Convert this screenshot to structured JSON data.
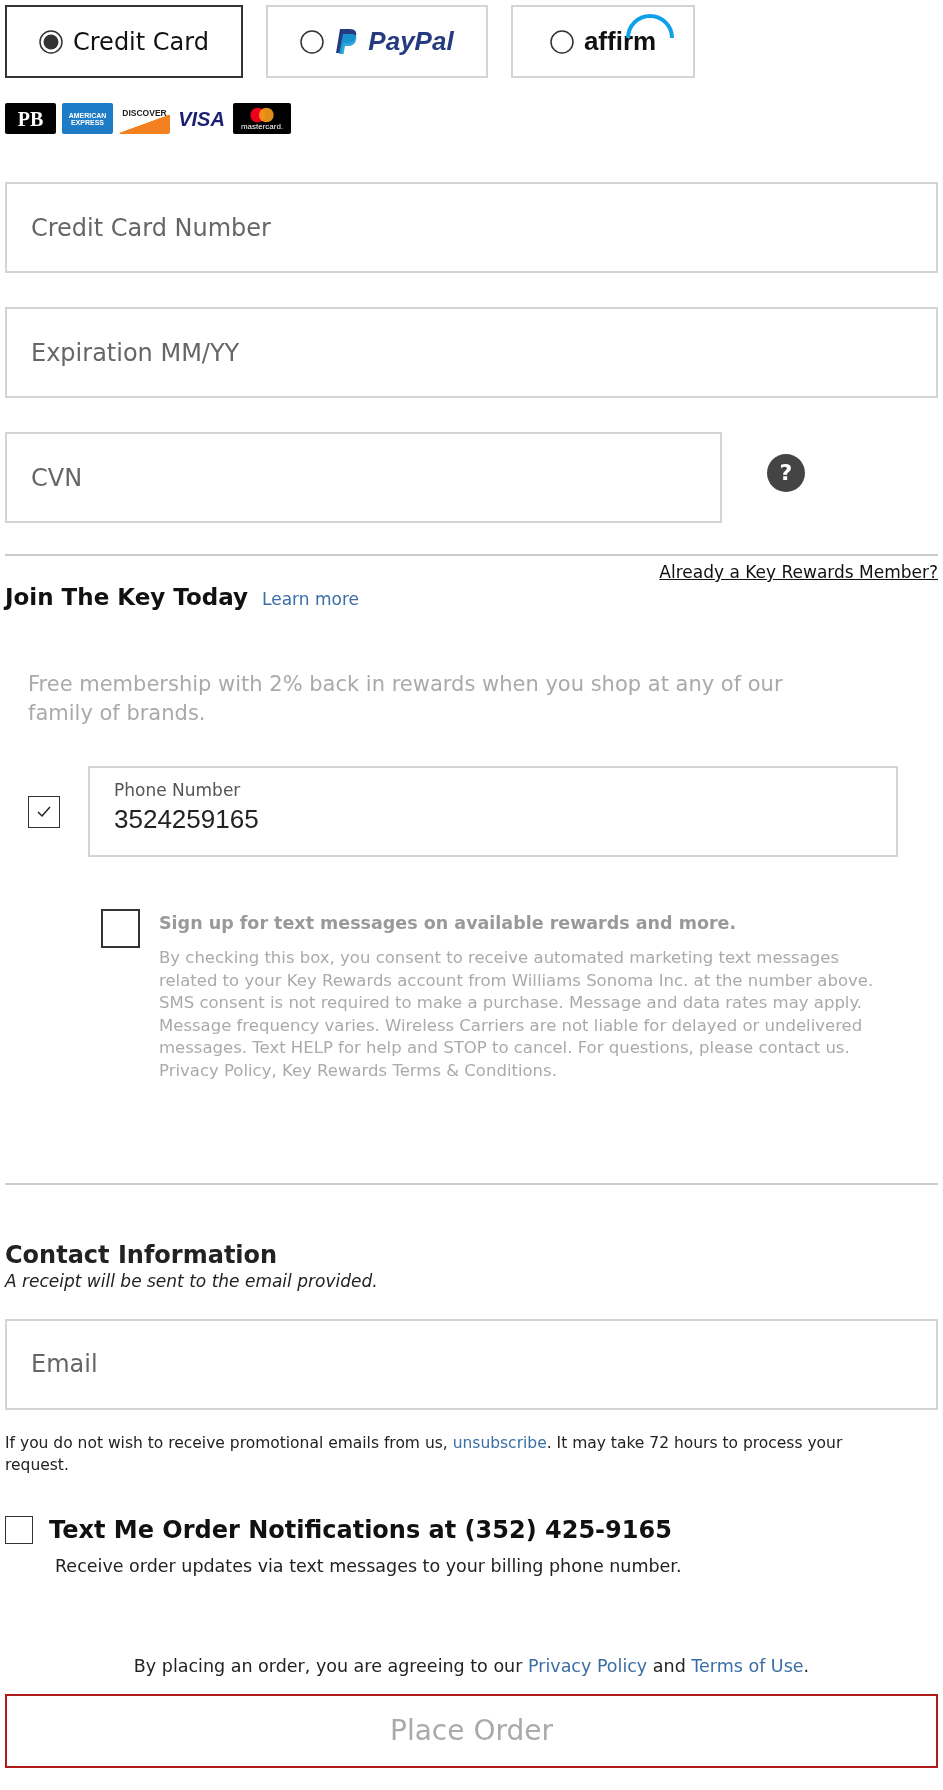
{
  "payment_methods": [
    {
      "kind": "text",
      "label": "Credit Card",
      "selected": true
    },
    {
      "kind": "paypal",
      "label": "PayPal",
      "selected": false
    },
    {
      "kind": "affirm",
      "label": "affirm",
      "selected": false
    }
  ],
  "card_logos": [
    {
      "kind": "pb",
      "label": "PB"
    },
    {
      "kind": "amex",
      "label": "AMERICAN EXPRESS"
    },
    {
      "kind": "discover",
      "label": "DISCOVER"
    },
    {
      "kind": "visa",
      "label": "VISA"
    },
    {
      "kind": "mastercard",
      "label": "mastercard."
    }
  ],
  "card_fields": [
    {
      "placeholder": "Credit Card Number"
    },
    {
      "placeholder": "Expiration MM/YY"
    }
  ],
  "cvn": {
    "placeholder": "CVN",
    "help": "?"
  },
  "rewards": {
    "member_link": "Already a Key Rewards Member?",
    "title": "Join The Key Today",
    "learn_more": "Learn more",
    "description": "Free membership with 2% back in rewards when you shop at any of our family of brands.",
    "phone_checked": true,
    "phone_label": "Phone Number",
    "phone_value": "3524259165",
    "sms_checked": false,
    "sms_title": "Sign up for text messages on available rewards and more.",
    "sms_body": "By checking this box, you consent to receive automated marketing text messages related to your Key Rewards account from Williams Sonoma Inc. at the number above. SMS consent is not required to make a purchase. Message and data rates may apply. Message frequency varies. Wireless Carriers are not liable for delayed or undelivered messages. Text HELP for help and STOP to cancel. For questions, please contact us. Privacy Policy, Key Rewards Terms & Conditions."
  },
  "contact": {
    "title": "Contact Information",
    "subtitle": "A receipt will be sent to the email provided.",
    "email_placeholder": "Email",
    "notice_before": "If you do not wish to receive promotional emails from us,",
    "notice_link": "unsubscribe",
    "notice_after": ". It may take 72 hours to process your request."
  },
  "notifications": {
    "checked": false,
    "label": "Text Me Order Notifications at (352) 425-9165",
    "description": "Receive order updates via text messages to your billing phone number."
  },
  "agreement": {
    "before": "By placing an order, you are agreeing to our",
    "privacy": "Privacy Policy",
    "and": "and",
    "terms": "Terms of Use",
    "end": "."
  },
  "place_order": {
    "label": "Place Order",
    "disabled": true
  }
}
